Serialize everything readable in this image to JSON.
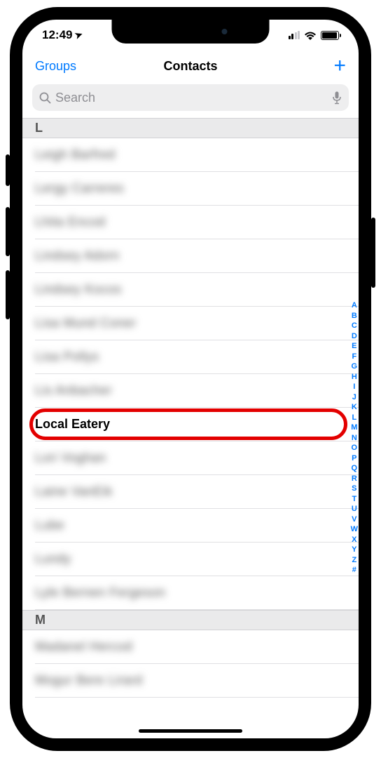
{
  "status": {
    "time": "12:49",
    "location_glyph": "➤"
  },
  "nav": {
    "left": "Groups",
    "title": "Contacts",
    "add": "+"
  },
  "search": {
    "placeholder": "Search"
  },
  "sections": [
    {
      "letter": "L"
    },
    {
      "letter": "M"
    }
  ],
  "contacts_L": [
    {
      "label": "Leigh Barfred",
      "blurred": true
    },
    {
      "label": "Lergy Carreres",
      "blurred": true
    },
    {
      "label": "Lhita Encod",
      "blurred": true
    },
    {
      "label": "Lindsey Adorn",
      "blurred": true
    },
    {
      "label": "Lindsey Kocos",
      "blurred": true
    },
    {
      "label": "Lisa Mund Coner",
      "blurred": true
    },
    {
      "label": "Lisa Pollys",
      "blurred": true
    },
    {
      "label": "Lis Anbacher",
      "blurred": true
    },
    {
      "label": "Local Eatery",
      "blurred": false,
      "highlighted": true
    },
    {
      "label": "Lori Voghan",
      "blurred": true
    },
    {
      "label": "Laine VanEik",
      "blurred": true
    },
    {
      "label": "Lube",
      "blurred": true
    },
    {
      "label": "Lundy",
      "blurred": true
    },
    {
      "label": "Lyle Bernen Fergeson",
      "blurred": true
    }
  ],
  "contacts_M": [
    {
      "label": "Madanel Hercod",
      "blurred": true
    },
    {
      "label": "Mogur Bere Lirard",
      "blurred": true
    }
  ],
  "index": [
    "A",
    "B",
    "C",
    "D",
    "E",
    "F",
    "G",
    "H",
    "I",
    "J",
    "K",
    "L",
    "M",
    "N",
    "O",
    "P",
    "Q",
    "R",
    "S",
    "T",
    "U",
    "V",
    "W",
    "X",
    "Y",
    "Z",
    "#"
  ]
}
